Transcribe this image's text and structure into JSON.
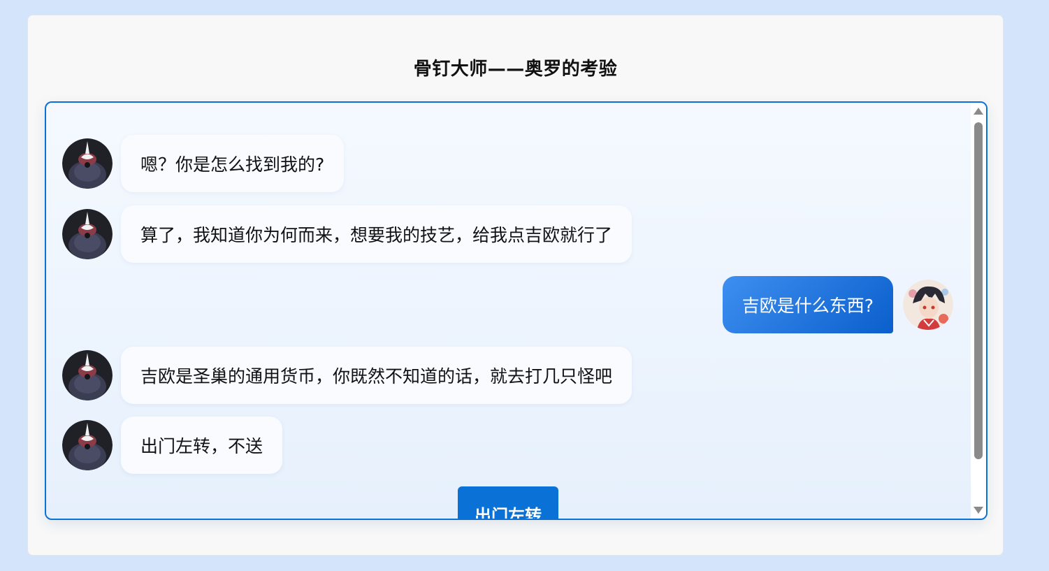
{
  "title": "骨钉大师——奥罗的考验",
  "messages": [
    {
      "side": "left",
      "text": "嗯？你是怎么找到我的?"
    },
    {
      "side": "left",
      "text": "算了，我知道你为何而来，想要我的技艺，给我点吉欧就行了"
    },
    {
      "side": "right",
      "text": "吉欧是什么东西?"
    },
    {
      "side": "left",
      "text": "吉欧是圣巢的通用货币，你既然不知道的话，就去打几只怪吧"
    },
    {
      "side": "left",
      "text": "出门左转，不送"
    }
  ],
  "action_button": "出门左转",
  "colors": {
    "accent": "#0a72d6",
    "user_bubble": "#2f80e8",
    "npc_bubble": "#f9fbff",
    "page_bg": "#d3e4fb"
  },
  "icons": {
    "npc_avatar": "oro-avatar-icon",
    "user_avatar": "player-avatar-icon"
  }
}
